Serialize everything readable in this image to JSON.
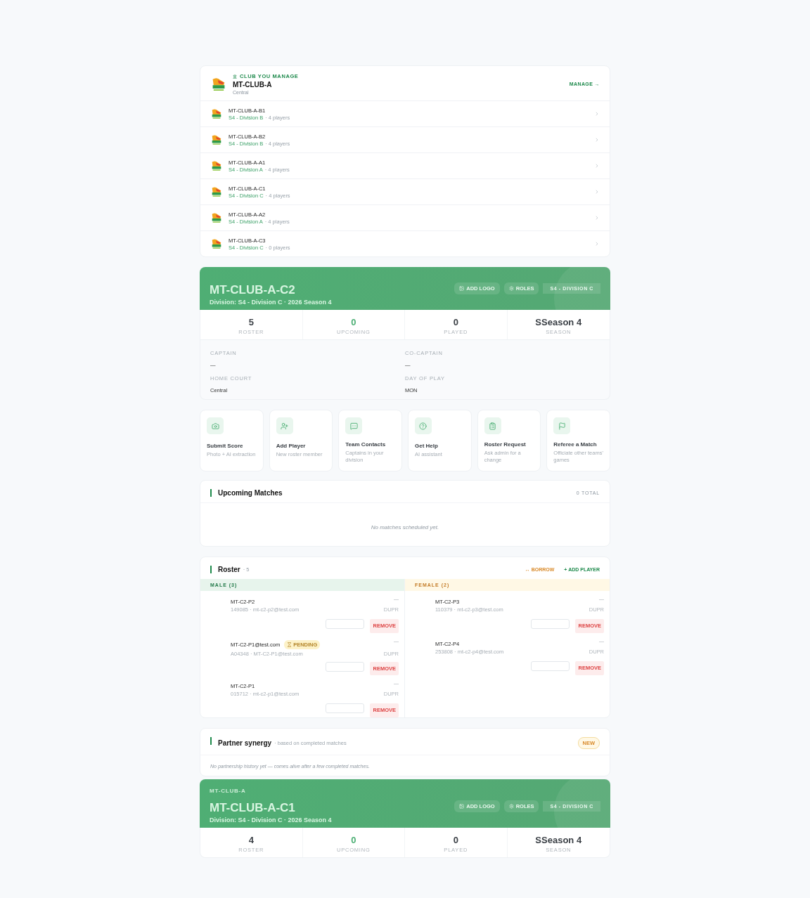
{
  "club": {
    "eyebrow": "CLUB YOU MANAGE",
    "name": "MT-CLUB-A",
    "region": "Central",
    "manage_link": "MANAGE →",
    "teams": [
      {
        "name": "MT-CLUB-A-B1",
        "division": "S4 - Division B",
        "players": " · 4 players"
      },
      {
        "name": "MT-CLUB-A-B2",
        "division": "S4 - Division B",
        "players": " · 4 players"
      },
      {
        "name": "MT-CLUB-A-A1",
        "division": "S4 - Division A",
        "players": " · 4 players"
      },
      {
        "name": "MT-CLUB-A-C1",
        "division": "S4 - Division C",
        "players": " · 4 players"
      },
      {
        "name": "MT-CLUB-A-A2",
        "division": "S4 - Division A",
        "players": " · 4 players"
      },
      {
        "name": "MT-CLUB-A-C3",
        "division": "S4 - Division C",
        "players": " · 0 players"
      }
    ]
  },
  "team": {
    "name": "MT-CLUB-A-C2",
    "subtitle": "Division: S4 - Division C · 2026 Season 4",
    "buttons": [
      "ADD LOGO",
      "ROLES"
    ],
    "badge": "S4 - DIVISION C",
    "stats": [
      {
        "value": "5",
        "label": "ROSTER",
        "accent": false
      },
      {
        "value": "0",
        "label": "UPCOMING",
        "accent": true
      },
      {
        "value": "0",
        "label": "PLAYED",
        "accent": false
      },
      {
        "value": "SSeason 4",
        "label": "SEASON",
        "accent": false
      }
    ],
    "details": [
      {
        "label": "CAPTAIN",
        "value": "—"
      },
      {
        "label": "CO-CAPTAIN",
        "value": "—"
      },
      {
        "label": "HOME COURT",
        "value": "Central"
      },
      {
        "label": "DAY OF PLAY",
        "value": "MON"
      }
    ]
  },
  "actions": [
    {
      "kind": "camera",
      "title": "Submit Score",
      "subtitle": "Photo + AI extraction"
    },
    {
      "kind": "user-plus",
      "title": "Add Player",
      "subtitle": "New roster member"
    },
    {
      "kind": "chat",
      "title": "Team Contacts",
      "subtitle": "Captains in your division"
    },
    {
      "kind": "help",
      "title": "Get Help",
      "subtitle": "AI assistant"
    },
    {
      "kind": "clipboard",
      "title": "Roster Request",
      "subtitle": "Ask admin for a change"
    },
    {
      "kind": "flag",
      "title": "Referee a Match",
      "subtitle": "Officiate other teams' games"
    }
  ],
  "upcoming": {
    "title": "Upcoming Matches",
    "total": "0 TOTAL",
    "empty": "No matches scheduled yet."
  },
  "roster": {
    "title": "Roster",
    "count": "· 5",
    "borrow": "↔ BORROW",
    "add": "+ ADD PLAYER",
    "groups": [
      {
        "kind": "male",
        "label": "MALE (3)",
        "players": [
          {
            "name": "MT-C2-P2",
            "sub": "149085 · mt-c2-p2@test.com",
            "rating": "—",
            "rating_label": "DUPR",
            "remove": "REMOVE"
          },
          {
            "name": "MT-C2-P1@test.com",
            "sub": "A04348 · MT-C2-P1@test.com",
            "rating": "—",
            "rating_label": "DUPR",
            "remove": "REMOVE",
            "badge": "PENDING"
          },
          {
            "name": "MT-C2-P1",
            "sub": "015712 · mt-c2-p1@test.com",
            "rating": "—",
            "rating_label": "DUPR",
            "remove": "REMOVE"
          }
        ]
      },
      {
        "kind": "female",
        "label": "FEMALE (2)",
        "players": [
          {
            "name": "MT-C2-P3",
            "sub": "110379 · mt-c2-p3@test.com",
            "rating": "—",
            "rating_label": "DUPR",
            "remove": "REMOVE"
          },
          {
            "name": "MT-C2-P4",
            "sub": "253808 · mt-c2-p4@test.com",
            "rating": "—",
            "rating_label": "DUPR",
            "remove": "REMOVE"
          }
        ]
      }
    ]
  },
  "synergy": {
    "title": "Partner synergy",
    "subtitle": "· based on completed matches",
    "badge": "NEW",
    "empty": "No partnership history yet — comes alive after a few completed matches."
  },
  "team_2": {
    "club": "MT-CLUB-A",
    "name": "MT-CLUB-A-C1",
    "subtitle": "Division: S4 - Division C · 2026 Season 4",
    "buttons": [
      "ADD LOGO",
      "ROLES"
    ],
    "badge": "S4 - DIVISION C",
    "stats": [
      {
        "value": "4",
        "label": "ROSTER",
        "accent": false
      },
      {
        "value": "0",
        "label": "UPCOMING",
        "accent": true
      },
      {
        "value": "0",
        "label": "PLAYED",
        "accent": false
      },
      {
        "value": "SSeason 4",
        "label": "SEASON",
        "accent": false
      }
    ]
  }
}
